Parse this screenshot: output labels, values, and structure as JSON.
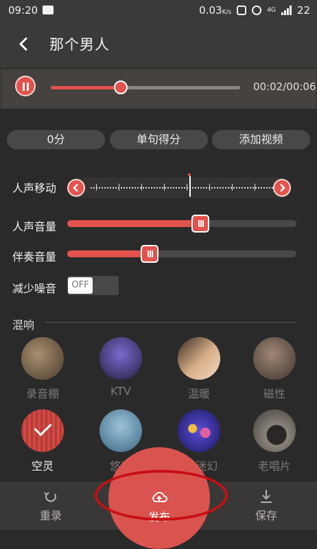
{
  "status_bar": {
    "time": "09:20",
    "speed": "0.03",
    "speed_unit": "K/s",
    "network": "4G",
    "battery": "22"
  },
  "header": {
    "title": "那个男人"
  },
  "player": {
    "time": "00:02/00:06",
    "progress": 0.37
  },
  "pills": [
    "0分",
    "单句得分",
    "添加视频"
  ],
  "controls": {
    "voice_move_label": "人声移动",
    "voice_volume_label": "人声音量",
    "voice_volume": 0.58,
    "accompaniment_label": "伴奏音量",
    "accompaniment_volume": 0.36,
    "noise_label": "减少噪音",
    "noise_toggle": "OFF"
  },
  "reverb": {
    "label": "混响",
    "items": [
      {
        "label": "录音棚",
        "icon": "microphone-icon",
        "color": "#6b5a44"
      },
      {
        "label": "KTV",
        "icon": "ktv-room-icon",
        "color": "#4a3d8a"
      },
      {
        "label": "温暖",
        "icon": "piano-icon",
        "color": "#b88a6a"
      },
      {
        "label": "磁性",
        "icon": "guitar-icon",
        "color": "#7a6558"
      },
      {
        "label": "空灵",
        "icon": "check-icon",
        "color": "#c2413c",
        "selected": true
      },
      {
        "label": "悠远",
        "icon": "birds-icon",
        "color": "#5f8aa6"
      },
      {
        "label": "3D迷幻",
        "icon": "lights-icon",
        "color": "#4a42b8"
      },
      {
        "label": "老唱片",
        "icon": "vinyl-icon",
        "color": "#6f6a63"
      }
    ]
  },
  "bottom_bar": {
    "rerecord": "重录",
    "publish": "发布",
    "save": "保存"
  }
}
